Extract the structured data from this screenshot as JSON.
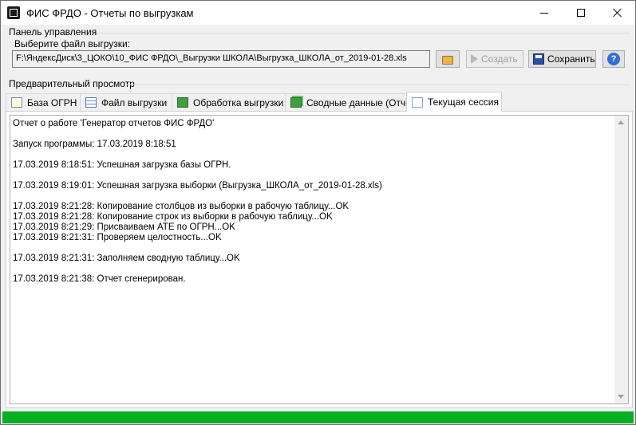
{
  "window": {
    "title": "ФИС ФРДО - Отчеты по выгрузкам"
  },
  "control_panel": {
    "group_label": "Панель управления",
    "file_label": "Выберите файл выгрузки:",
    "file_path": "F:\\ЯндексДиск\\3_ЦОКО\\10_ФИС ФРДО\\_Выгрузки ШКОЛА\\Выгрузка_ШКОЛА_от_2019-01-28.xls",
    "create_label": "Создать",
    "save_label": "Сохранить",
    "help_label": "?"
  },
  "preview": {
    "group_label": "Предварительный просмотр"
  },
  "tabs": [
    {
      "label": "База ОГРН",
      "icon": "database-icon"
    },
    {
      "label": "Файл выгрузки",
      "icon": "table-icon"
    },
    {
      "label": "Обработка выгрузки",
      "icon": "process-icon"
    },
    {
      "label": "Сводные данные (Отчет)",
      "icon": "summary-icon"
    },
    {
      "label": "Текущая сессия",
      "icon": "page-icon",
      "active": true
    }
  ],
  "log": {
    "text": "Отчет о работе 'Генератор отчетов ФИС ФРДО'\n\nЗапуск программы: 17.03.2019 8:18:51\n\n17.03.2019 8:18:51: Успешная загрузка базы ОГРН.\n\n17.03.2019 8:19:01: Успешная загрузка выборки (Выгрузка_ШКОЛА_от_2019-01-28.xls)\n\n17.03.2019 8:21:28: Копирование столбцов из выборки в рабочую таблицу...OK\n17.03.2019 8:21:28: Копирование строк из выборки в рабочую таблицу...OK\n17.03.2019 8:21:29: Присваиваем АТЕ по ОГРН...OK\n17.03.2019 8:21:31: Проверяем целостность...OK\n\n17.03.2019 8:21:31: Заполняем сводную таблицу...OK\n\n17.03.2019 8:21:38: Отчет сгенерирован."
  },
  "status": {
    "progress": 1.0,
    "progress_color": "#06b025"
  }
}
